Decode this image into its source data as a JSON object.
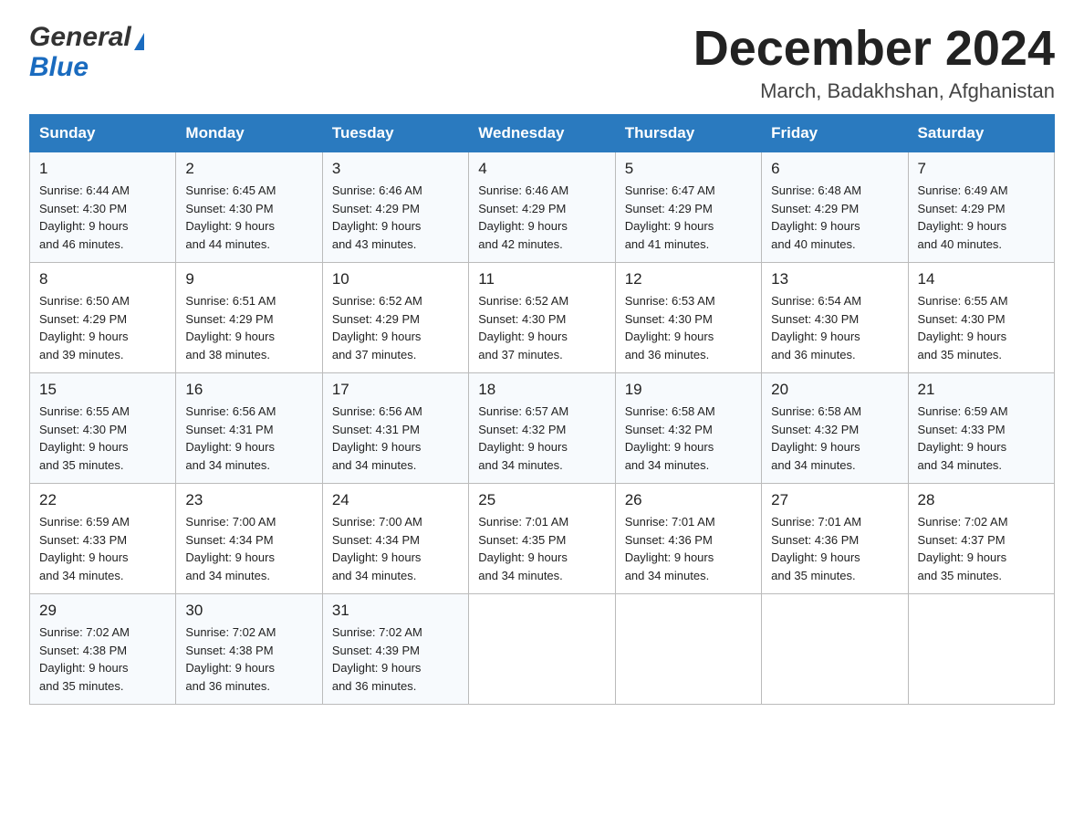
{
  "header": {
    "title": "December 2024",
    "subtitle": "March, Badakhshan, Afghanistan",
    "logo_line1": "General",
    "logo_line2": "Blue"
  },
  "weekdays": [
    "Sunday",
    "Monday",
    "Tuesday",
    "Wednesday",
    "Thursday",
    "Friday",
    "Saturday"
  ],
  "weeks": [
    [
      {
        "day": "1",
        "sunrise": "6:44 AM",
        "sunset": "4:30 PM",
        "daylight": "9 hours and 46 minutes."
      },
      {
        "day": "2",
        "sunrise": "6:45 AM",
        "sunset": "4:30 PM",
        "daylight": "9 hours and 44 minutes."
      },
      {
        "day": "3",
        "sunrise": "6:46 AM",
        "sunset": "4:29 PM",
        "daylight": "9 hours and 43 minutes."
      },
      {
        "day": "4",
        "sunrise": "6:46 AM",
        "sunset": "4:29 PM",
        "daylight": "9 hours and 42 minutes."
      },
      {
        "day": "5",
        "sunrise": "6:47 AM",
        "sunset": "4:29 PM",
        "daylight": "9 hours and 41 minutes."
      },
      {
        "day": "6",
        "sunrise": "6:48 AM",
        "sunset": "4:29 PM",
        "daylight": "9 hours and 40 minutes."
      },
      {
        "day": "7",
        "sunrise": "6:49 AM",
        "sunset": "4:29 PM",
        "daylight": "9 hours and 40 minutes."
      }
    ],
    [
      {
        "day": "8",
        "sunrise": "6:50 AM",
        "sunset": "4:29 PM",
        "daylight": "9 hours and 39 minutes."
      },
      {
        "day": "9",
        "sunrise": "6:51 AM",
        "sunset": "4:29 PM",
        "daylight": "9 hours and 38 minutes."
      },
      {
        "day": "10",
        "sunrise": "6:52 AM",
        "sunset": "4:29 PM",
        "daylight": "9 hours and 37 minutes."
      },
      {
        "day": "11",
        "sunrise": "6:52 AM",
        "sunset": "4:30 PM",
        "daylight": "9 hours and 37 minutes."
      },
      {
        "day": "12",
        "sunrise": "6:53 AM",
        "sunset": "4:30 PM",
        "daylight": "9 hours and 36 minutes."
      },
      {
        "day": "13",
        "sunrise": "6:54 AM",
        "sunset": "4:30 PM",
        "daylight": "9 hours and 36 minutes."
      },
      {
        "day": "14",
        "sunrise": "6:55 AM",
        "sunset": "4:30 PM",
        "daylight": "9 hours and 35 minutes."
      }
    ],
    [
      {
        "day": "15",
        "sunrise": "6:55 AM",
        "sunset": "4:30 PM",
        "daylight": "9 hours and 35 minutes."
      },
      {
        "day": "16",
        "sunrise": "6:56 AM",
        "sunset": "4:31 PM",
        "daylight": "9 hours and 34 minutes."
      },
      {
        "day": "17",
        "sunrise": "6:56 AM",
        "sunset": "4:31 PM",
        "daylight": "9 hours and 34 minutes."
      },
      {
        "day": "18",
        "sunrise": "6:57 AM",
        "sunset": "4:32 PM",
        "daylight": "9 hours and 34 minutes."
      },
      {
        "day": "19",
        "sunrise": "6:58 AM",
        "sunset": "4:32 PM",
        "daylight": "9 hours and 34 minutes."
      },
      {
        "day": "20",
        "sunrise": "6:58 AM",
        "sunset": "4:32 PM",
        "daylight": "9 hours and 34 minutes."
      },
      {
        "day": "21",
        "sunrise": "6:59 AM",
        "sunset": "4:33 PM",
        "daylight": "9 hours and 34 minutes."
      }
    ],
    [
      {
        "day": "22",
        "sunrise": "6:59 AM",
        "sunset": "4:33 PM",
        "daylight": "9 hours and 34 minutes."
      },
      {
        "day": "23",
        "sunrise": "7:00 AM",
        "sunset": "4:34 PM",
        "daylight": "9 hours and 34 minutes."
      },
      {
        "day": "24",
        "sunrise": "7:00 AM",
        "sunset": "4:34 PM",
        "daylight": "9 hours and 34 minutes."
      },
      {
        "day": "25",
        "sunrise": "7:01 AM",
        "sunset": "4:35 PM",
        "daylight": "9 hours and 34 minutes."
      },
      {
        "day": "26",
        "sunrise": "7:01 AM",
        "sunset": "4:36 PM",
        "daylight": "9 hours and 34 minutes."
      },
      {
        "day": "27",
        "sunrise": "7:01 AM",
        "sunset": "4:36 PM",
        "daylight": "9 hours and 35 minutes."
      },
      {
        "day": "28",
        "sunrise": "7:02 AM",
        "sunset": "4:37 PM",
        "daylight": "9 hours and 35 minutes."
      }
    ],
    [
      {
        "day": "29",
        "sunrise": "7:02 AM",
        "sunset": "4:38 PM",
        "daylight": "9 hours and 35 minutes."
      },
      {
        "day": "30",
        "sunrise": "7:02 AM",
        "sunset": "4:38 PM",
        "daylight": "9 hours and 36 minutes."
      },
      {
        "day": "31",
        "sunrise": "7:02 AM",
        "sunset": "4:39 PM",
        "daylight": "9 hours and 36 minutes."
      },
      null,
      null,
      null,
      null
    ]
  ],
  "labels": {
    "sunrise": "Sunrise:",
    "sunset": "Sunset:",
    "daylight": "Daylight:"
  },
  "colors": {
    "header_bg": "#2a7abf",
    "header_text": "#ffffff"
  }
}
